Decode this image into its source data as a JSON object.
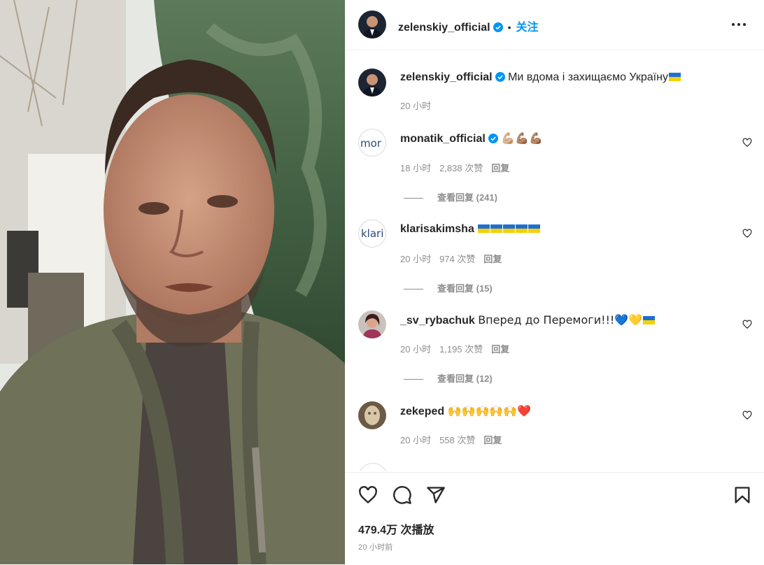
{
  "post": {
    "username": "zelenskiy_official",
    "follow_label": "关注",
    "separator": "•",
    "plays": "479.4万 次播放",
    "timestamp": "20 小时前"
  },
  "caption": {
    "username": "zelenskiy_official",
    "text": "Ми вдома і захищаємо Україну",
    "time": "20 小时"
  },
  "comments": [
    {
      "username": "monatik_official",
      "verified": true,
      "text": "💪🏼💪🏽💪🏽",
      "time": "18 小时",
      "likes": "2,838 次赞",
      "reply": "回复",
      "view_replies": "查看回复 (241)",
      "avatar_text": "mor"
    },
    {
      "username": "klarisakimsha",
      "verified": false,
      "text": "",
      "flags": 5,
      "time": "20 小时",
      "likes": "974 次赞",
      "reply": "回复",
      "view_replies": "查看回复 (15)",
      "avatar_text": "klari"
    },
    {
      "username": "_sv_rybachuk",
      "verified": false,
      "text": "Вперед до Перемоги!!!💙💛",
      "flags": 1,
      "time": "20 小时",
      "likes": "1,195 次赞",
      "reply": "回复",
      "view_replies": "查看回复 (12)"
    },
    {
      "username": "zekeped",
      "verified": false,
      "text": "🙌🙌🙌🙌🙌❤️",
      "time": "20 小时",
      "likes": "558 次赞",
      "reply": "回复"
    }
  ],
  "colors": {
    "accent": "#0095f6",
    "verified": "#0095f6",
    "muted": "#8e8e8e",
    "text": "#262626"
  }
}
